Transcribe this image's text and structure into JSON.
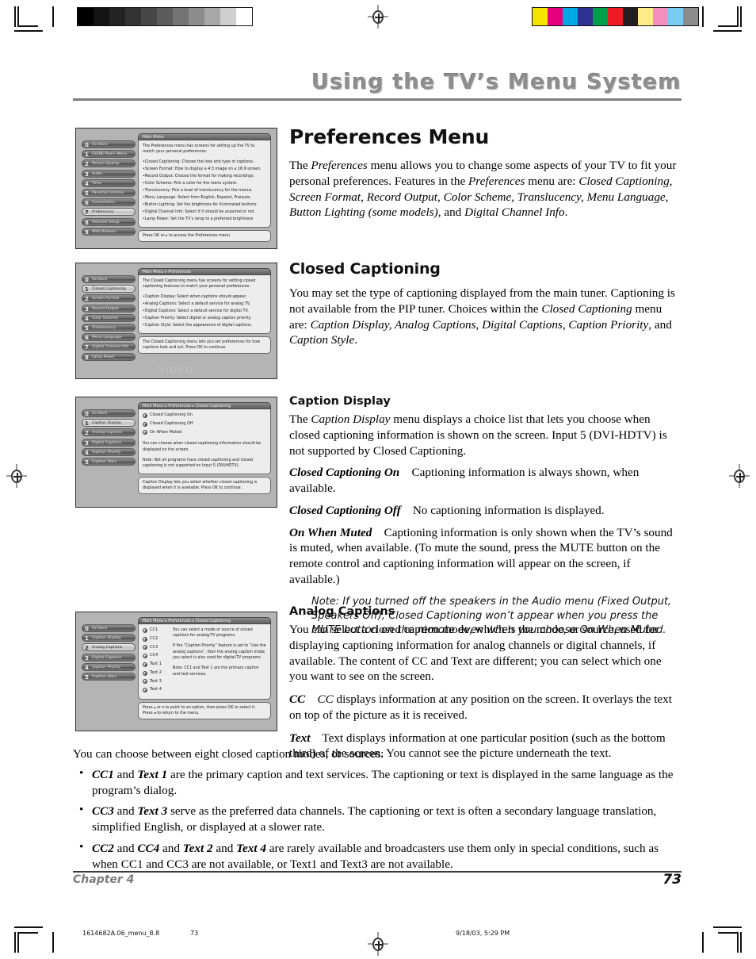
{
  "header": {
    "title": "Using the TV’s Menu System"
  },
  "footer": {
    "chapter": "Chapter 4",
    "page_number": "73",
    "slug_file": "1614682A.06_menu_8.8",
    "slug_page": "73",
    "slug_date": "9/18/03, 5:29 PM"
  },
  "colorbars": {
    "gray": [
      "#000000",
      "#131313",
      "#232323",
      "#333333",
      "#474747",
      "#5c5c5c",
      "#737373",
      "#8d8d8d",
      "#a8a8a8",
      "#cfcfcf",
      "#ffffff"
    ],
    "color": [
      "#f5e400",
      "#e5007d",
      "#00a7e2",
      "#2e3192",
      "#00a04a",
      "#ed1c24",
      "#231f20",
      "#fced8a",
      "#f48fc0",
      "#79cdf2",
      "#8c8c8c"
    ]
  },
  "sections": {
    "preferences": {
      "heading": "Preferences Menu",
      "paragraph": "The Preferences menu allows you to change some aspects of your TV to fit your personal preferences. Features in the Preferences menu are: Closed Captioning, Screen Format, Record Output, Color Scheme, Translucency, Menu Language, Button Lighting (some models), and Digital Channel Info."
    },
    "closed_captioning": {
      "heading": "Closed Captioning",
      "paragraph": "You may set the type of captioning displayed from the main tuner. Captioning is not available from the PIP tuner. Choices within the Closed Captioning menu are: Caption Display, Analog Captions, Digital Captions, Caption Priority, and Caption Style."
    },
    "caption_display": {
      "heading": "Caption Display",
      "paragraph": "The Caption Display menu displays a choice list that lets you choose when closed captioning information is shown on the screen. Input 5 (DVI-HDTV) is not supported by Closed Captioning.",
      "options": [
        {
          "term": "Closed Captioning On",
          "definition": "Captioning information is always shown, when available."
        },
        {
          "term": "Closed Captioning Off",
          "definition": "No captioning information is displayed."
        },
        {
          "term": "On When Muted",
          "definition": "Captioning information is only shown when the TV’s sound is muted, when available. (To mute the sound, press the MUTE button on the remote control and captioning information will appear on the screen, if available.)"
        }
      ],
      "note": "Note: If you turned off the speakers in the Audio menu (Fixed Output, Speakers Off), Closed Captioning won’t appear when you press the MUTE button on the remote even when you choose On When Muted."
    },
    "analog_captions": {
      "heading": "Analog Captions",
      "paragraph": "You can select a closed caption mode, which is the mode, or source, used for displaying captioning information for analog channels or digital channels, if available. The content of CC and Text are different; you can select which one you want to see on the screen.",
      "options": [
        {
          "term": "CC",
          "definition": "CC displays information at any position on the screen. It overlays the text on top of the picture as it is received."
        },
        {
          "term": "Text",
          "definition": "Text displays information at one particular position (such as the bottom third) of the screen. You cannot see the picture underneath the text."
        }
      ],
      "intro": "You can choose between eight closed caption modes, or sources:",
      "bullets": [
        "CC1 and Text 1 are the primary caption and text services. The captioning or text is displayed in the same language as the program’s dialog.",
        "CC3 and Text 3 serve as the preferred data channels. The captioning or text is often a secondary language translation, simplified English, or displayed at a slower rate.",
        "CC2 and CC4 and Text 2 and Text 4 are rarely available and broadcasters use them only in special conditions, such as when CC1 and CC3 are not available, or Text1 and Text3 are not available."
      ]
    }
  },
  "screenshots": {
    "main_menu": {
      "title": "Main Menu",
      "items": [
        {
          "num": "0",
          "label": "Go Back",
          "selected": false
        },
        {
          "num": "1",
          "label": "GUIDE Plus+ Menu",
          "selected": false
        },
        {
          "num": "2",
          "label": "Picture Quality",
          "selected": false
        },
        {
          "num": "3",
          "label": "Audio",
          "selected": false
        },
        {
          "num": "4",
          "label": "Time",
          "selected": false
        },
        {
          "num": "5",
          "label": "Parental Controls",
          "selected": false
        },
        {
          "num": "6",
          "label": "Connections",
          "selected": false
        },
        {
          "num": "7",
          "label": "Preferences",
          "selected": true
        },
        {
          "num": "8",
          "label": "Assisted Setup",
          "selected": false
        },
        {
          "num": "9",
          "label": "Web Browser",
          "selected": false
        }
      ],
      "intro": "The Preferences menu has screens for setting up the TV to match your personal preferences:",
      "lines": [
        "•Closed Captioning: Choose the look and type of captions.",
        "•Screen Format: How to display a 4:3 image on a 16:9 screen.",
        "•Record Output: Choose the format for making recordings.",
        "•Color Scheme: Pick a color for the menu system.",
        "•Translucency: Pick a level of translucency for the menus.",
        "•Menu Language: Select from English, Español, Français.",
        "•Button Lighting: Set the brightness for illuminated buttons.",
        "•Digital Channel Info: Select if it should be acquired or not.",
        "•Lamp Power: Set the TV’s lamp to a preferred brightness"
      ],
      "hint": "Press OK or ▸ to access the Preferences menu."
    },
    "preferences_menu": {
      "title": "Main Menu ▸ Preferences",
      "items": [
        {
          "num": "0",
          "label": "Go Back",
          "selected": false
        },
        {
          "num": "1",
          "label": "Closed Captioning",
          "selected": true
        },
        {
          "num": "2",
          "label": "Screen Format",
          "selected": false
        },
        {
          "num": "3",
          "label": "Record Output",
          "selected": false
        },
        {
          "num": "4",
          "label": "Color Scheme",
          "selected": false
        },
        {
          "num": "5",
          "label": "Translucency",
          "selected": false
        },
        {
          "num": "6",
          "label": "Menu Language",
          "selected": false
        },
        {
          "num": "7",
          "label": "Digital Channel Info",
          "selected": false
        },
        {
          "num": "8",
          "label": "Lamp Power",
          "selected": false
        }
      ],
      "intro": "The Closed Captioning menu has screens for setting closed captioning features to match your personal preferences:",
      "lines": [
        "•Caption Display: Select when captions should appear.",
        "•Analog Captions: Select a default service for analog TV.",
        "•Digital Captions: Select a default service for digital TV.",
        "•Caption Priority: Select digital or analog caption priority.",
        "•Caption Style: Select the appearance of digital captions."
      ],
      "hint": "The Closed Captioning menu lets you set preferences for how captions look and act. Press OK to continue.",
      "watermark": "VIDEO"
    },
    "caption_display_menu": {
      "title": "Main Menu ▸ Preferences ▸ Closed Captioning",
      "items": [
        {
          "num": "0",
          "label": "Go Back",
          "selected": false
        },
        {
          "num": "1",
          "label": "Caption Display",
          "selected": true
        },
        {
          "num": "2",
          "label": "Analog Captions",
          "selected": false
        },
        {
          "num": "3",
          "label": "Digital Captions",
          "selected": false
        },
        {
          "num": "4",
          "label": "Caption Priority",
          "selected": false
        },
        {
          "num": "5",
          "label": "Caption Style",
          "selected": false
        }
      ],
      "choices": [
        "Closed Captioning On",
        "Closed Captioning Off",
        "On When Muted"
      ],
      "body1": "You can choose when closed captioning information should be displayed on the screen.",
      "body2": "Note: Not all programs have closed captioning and closed captioning is not supported on Input 5 (DVI/HDTV).",
      "hint": "Caption Display lets you select whether closed captioning is displayed when it is available. Press OK to continue."
    },
    "analog_captions_menu": {
      "title": "Main Menu ▸ Preferences ▸ Closed Captioning",
      "items": [
        {
          "num": "0",
          "label": "Go Back",
          "selected": false
        },
        {
          "num": "1",
          "label": "Caption Display",
          "selected": false
        },
        {
          "num": "2",
          "label": "Analog Captions",
          "selected": true
        },
        {
          "num": "3",
          "label": "Digital Captions",
          "selected": false
        },
        {
          "num": "4",
          "label": "Caption Priority",
          "selected": false
        },
        {
          "num": "5",
          "label": "Caption Style",
          "selected": false
        }
      ],
      "choices": [
        "CC1",
        "CC2",
        "CC3",
        "CC4",
        "Text 1",
        "Text 2",
        "Text 3",
        "Text 4"
      ],
      "body1": "You can select a mode or source of closed captions for analog-TV programs.",
      "body2": "If the “Caption Priority” feature is set to “Use the analog captions”, then the analog caption mode you select is also used for digital-TV programs.",
      "body3": "Note: CC1 and Text 1 are the primary caption and text services.",
      "hint": "Press ▴ or ▾ to point to an option, then press OK to select it. Press ◂ to return to the menu."
    }
  }
}
